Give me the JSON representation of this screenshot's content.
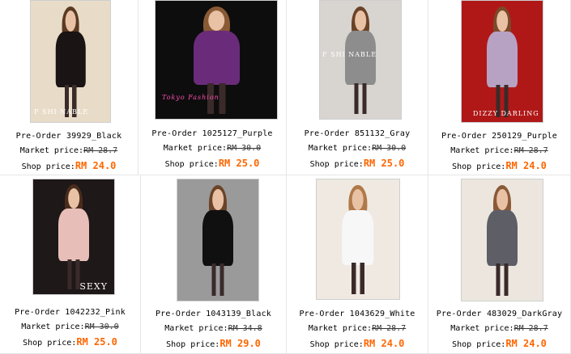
{
  "labels": {
    "market": "Market price:",
    "shop": "Shop price:"
  },
  "products": [
    {
      "name": "Pre-Order 39929_Black",
      "market_price": "RM 28.7",
      "shop_price": "RM 24.0",
      "brand_tag": "F SHI NABLE",
      "colors": {
        "bg": "#e8dcc8",
        "dress": "#1a1414",
        "hair": "#5b3a22",
        "accent": "#d9a0a0"
      }
    },
    {
      "name": "Pre-Order 1025127_Purple",
      "market_price": "RM 30.0",
      "shop_price": "RM 25.0",
      "brand_tag": "Tokyo Fashion",
      "colors": {
        "bg": "#0d0d0d",
        "dress": "#6a2c7a",
        "hair": "#8a5a35",
        "accent": "#e040a0"
      }
    },
    {
      "name": "Pre-Order 851132_Gray",
      "market_price": "RM 30.0",
      "shop_price": "RM 25.0",
      "brand_tag": "F SHI NABLE",
      "colors": {
        "bg": "#d8d4cf",
        "dress": "#8d8d8d",
        "hair": "#6a4228",
        "accent": "#d04060"
      }
    },
    {
      "name": "Pre-Order 250129_Purple",
      "market_price": "RM 28.7",
      "shop_price": "RM 24.0",
      "brand_tag": "DIZZY DARLING",
      "colors": {
        "bg": "#b01818",
        "dress": "#b7a2c4",
        "hair": "#7a4a2a",
        "accent": "#1a1a1a"
      }
    },
    {
      "name": "Pre-Order 1042232_Pink",
      "market_price": "RM 30.0",
      "shop_price": "RM 25.0",
      "brand_tag": "SEXY",
      "colors": {
        "bg": "#1e1818",
        "dress": "#e8bfb8",
        "hair": "#4a2c1c",
        "accent": "#ffffff"
      }
    },
    {
      "name": "Pre-Order 1043139_Black",
      "market_price": "RM 34.8",
      "shop_price": "RM 29.0",
      "brand_tag": "",
      "colors": {
        "bg": "#9a9a9a",
        "dress": "#101010",
        "hair": "#6a4428",
        "accent": "#c8c8c8"
      }
    },
    {
      "name": "Pre-Order 1043629_White",
      "market_price": "RM 28.7",
      "shop_price": "RM 24.0",
      "brand_tag": "",
      "colors": {
        "bg": "#efe9e2",
        "dress": "#f7f7f7",
        "hair": "#b07a48",
        "accent": "#6a3a2a"
      }
    },
    {
      "name": "Pre-Order 483029_DarkGray",
      "market_price": "RM 28.7",
      "shop_price": "RM 24.0",
      "brand_tag": "",
      "colors": {
        "bg": "#ece6df",
        "dress": "#5e5e66",
        "hair": "#8a5a38",
        "accent": "#ffffff"
      }
    }
  ]
}
